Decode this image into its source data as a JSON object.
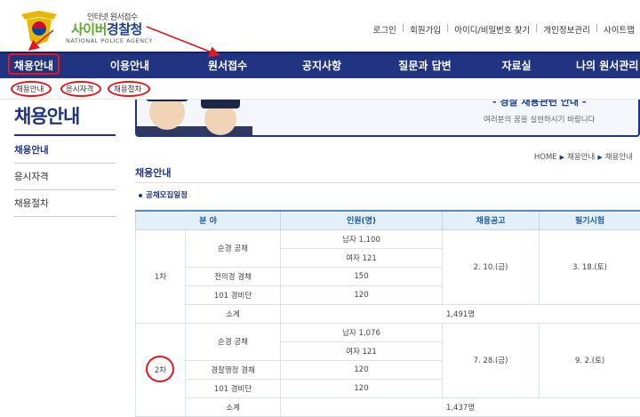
{
  "logo": {
    "small": "인터넷 원서접수",
    "main_a": "사이버",
    "main_b": "경찰청",
    "english": "NATIONAL POLICE AGENCY"
  },
  "util_links": [
    "로그인",
    "회원가입",
    "아이디/비밀번호 찾기",
    "개인정보관리",
    "사이트맵"
  ],
  "nav": [
    "채용안내",
    "이용안내",
    "원서접수",
    "공지사항",
    "질문과 답변",
    "자료실",
    "나의 원서관리"
  ],
  "subnav": [
    "채용안내",
    "응시자격",
    "채용절차"
  ],
  "sidebar": {
    "title": "채용안내",
    "items": [
      "채용안내",
      "응시자격",
      "채용절차"
    ]
  },
  "banner": {
    "headline": "- 경찰 채용관련 안내 -",
    "tagline": "여러분의 꿈을 실현하시기 바랍니다"
  },
  "breadcrumb": [
    "HOME",
    "채용안내",
    "채용안내"
  ],
  "content": {
    "title": "채용안내",
    "subheading": "공채모집일정"
  },
  "table": {
    "headers": [
      "분 야",
      "인원(명)",
      "채용공고",
      "필기시험"
    ],
    "round1": {
      "label": "1차",
      "r1_field": "순경 공채",
      "r1_count": "남자 1,100",
      "r2_count": "여자 121",
      "r3_field": "전의경 경채",
      "r3_count": "150",
      "r4_field": "101 경비단",
      "r4_count": "120",
      "notice": "2. 10.(금)",
      "exam": "3. 18.(토)",
      "subtotal_label": "소계",
      "subtotal": "1,491명"
    },
    "round2": {
      "label": "2차",
      "r1_field": "순경 공채",
      "r1_count": "남자 1,076",
      "r2_count": "여자 121",
      "r3_field": "경찰행정 경채",
      "r3_count": "120",
      "r4_field": "101 경비단",
      "r4_count": "120",
      "notice": "7. 28.(금)",
      "exam": "9. 2.(토)",
      "subtotal_label": "소계",
      "subtotal": "1,437명"
    }
  },
  "colors": {
    "nav": "#203481",
    "annotation": "#e5161d",
    "header_blue": "#1a5a9e",
    "logo_green": "#5ba829"
  }
}
